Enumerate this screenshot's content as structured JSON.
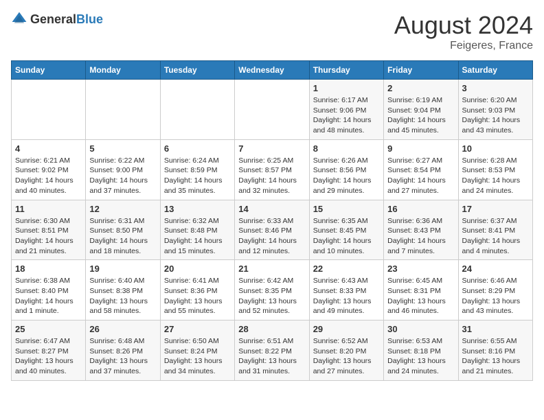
{
  "header": {
    "logo_general": "General",
    "logo_blue": "Blue",
    "month_year": "August 2024",
    "location": "Feigeres, France"
  },
  "calendar": {
    "days_of_week": [
      "Sunday",
      "Monday",
      "Tuesday",
      "Wednesday",
      "Thursday",
      "Friday",
      "Saturday"
    ],
    "weeks": [
      [
        {
          "day": "",
          "info": ""
        },
        {
          "day": "",
          "info": ""
        },
        {
          "day": "",
          "info": ""
        },
        {
          "day": "",
          "info": ""
        },
        {
          "day": "1",
          "info": "Sunrise: 6:17 AM\nSunset: 9:06 PM\nDaylight: 14 hours\nand 48 minutes."
        },
        {
          "day": "2",
          "info": "Sunrise: 6:19 AM\nSunset: 9:04 PM\nDaylight: 14 hours\nand 45 minutes."
        },
        {
          "day": "3",
          "info": "Sunrise: 6:20 AM\nSunset: 9:03 PM\nDaylight: 14 hours\nand 43 minutes."
        }
      ],
      [
        {
          "day": "4",
          "info": "Sunrise: 6:21 AM\nSunset: 9:02 PM\nDaylight: 14 hours\nand 40 minutes."
        },
        {
          "day": "5",
          "info": "Sunrise: 6:22 AM\nSunset: 9:00 PM\nDaylight: 14 hours\nand 37 minutes."
        },
        {
          "day": "6",
          "info": "Sunrise: 6:24 AM\nSunset: 8:59 PM\nDaylight: 14 hours\nand 35 minutes."
        },
        {
          "day": "7",
          "info": "Sunrise: 6:25 AM\nSunset: 8:57 PM\nDaylight: 14 hours\nand 32 minutes."
        },
        {
          "day": "8",
          "info": "Sunrise: 6:26 AM\nSunset: 8:56 PM\nDaylight: 14 hours\nand 29 minutes."
        },
        {
          "day": "9",
          "info": "Sunrise: 6:27 AM\nSunset: 8:54 PM\nDaylight: 14 hours\nand 27 minutes."
        },
        {
          "day": "10",
          "info": "Sunrise: 6:28 AM\nSunset: 8:53 PM\nDaylight: 14 hours\nand 24 minutes."
        }
      ],
      [
        {
          "day": "11",
          "info": "Sunrise: 6:30 AM\nSunset: 8:51 PM\nDaylight: 14 hours\nand 21 minutes."
        },
        {
          "day": "12",
          "info": "Sunrise: 6:31 AM\nSunset: 8:50 PM\nDaylight: 14 hours\nand 18 minutes."
        },
        {
          "day": "13",
          "info": "Sunrise: 6:32 AM\nSunset: 8:48 PM\nDaylight: 14 hours\nand 15 minutes."
        },
        {
          "day": "14",
          "info": "Sunrise: 6:33 AM\nSunset: 8:46 PM\nDaylight: 14 hours\nand 12 minutes."
        },
        {
          "day": "15",
          "info": "Sunrise: 6:35 AM\nSunset: 8:45 PM\nDaylight: 14 hours\nand 10 minutes."
        },
        {
          "day": "16",
          "info": "Sunrise: 6:36 AM\nSunset: 8:43 PM\nDaylight: 14 hours\nand 7 minutes."
        },
        {
          "day": "17",
          "info": "Sunrise: 6:37 AM\nSunset: 8:41 PM\nDaylight: 14 hours\nand 4 minutes."
        }
      ],
      [
        {
          "day": "18",
          "info": "Sunrise: 6:38 AM\nSunset: 8:40 PM\nDaylight: 14 hours\nand 1 minute."
        },
        {
          "day": "19",
          "info": "Sunrise: 6:40 AM\nSunset: 8:38 PM\nDaylight: 13 hours\nand 58 minutes."
        },
        {
          "day": "20",
          "info": "Sunrise: 6:41 AM\nSunset: 8:36 PM\nDaylight: 13 hours\nand 55 minutes."
        },
        {
          "day": "21",
          "info": "Sunrise: 6:42 AM\nSunset: 8:35 PM\nDaylight: 13 hours\nand 52 minutes."
        },
        {
          "day": "22",
          "info": "Sunrise: 6:43 AM\nSunset: 8:33 PM\nDaylight: 13 hours\nand 49 minutes."
        },
        {
          "day": "23",
          "info": "Sunrise: 6:45 AM\nSunset: 8:31 PM\nDaylight: 13 hours\nand 46 minutes."
        },
        {
          "day": "24",
          "info": "Sunrise: 6:46 AM\nSunset: 8:29 PM\nDaylight: 13 hours\nand 43 minutes."
        }
      ],
      [
        {
          "day": "25",
          "info": "Sunrise: 6:47 AM\nSunset: 8:27 PM\nDaylight: 13 hours\nand 40 minutes."
        },
        {
          "day": "26",
          "info": "Sunrise: 6:48 AM\nSunset: 8:26 PM\nDaylight: 13 hours\nand 37 minutes."
        },
        {
          "day": "27",
          "info": "Sunrise: 6:50 AM\nSunset: 8:24 PM\nDaylight: 13 hours\nand 34 minutes."
        },
        {
          "day": "28",
          "info": "Sunrise: 6:51 AM\nSunset: 8:22 PM\nDaylight: 13 hours\nand 31 minutes."
        },
        {
          "day": "29",
          "info": "Sunrise: 6:52 AM\nSunset: 8:20 PM\nDaylight: 13 hours\nand 27 minutes."
        },
        {
          "day": "30",
          "info": "Sunrise: 6:53 AM\nSunset: 8:18 PM\nDaylight: 13 hours\nand 24 minutes."
        },
        {
          "day": "31",
          "info": "Sunrise: 6:55 AM\nSunset: 8:16 PM\nDaylight: 13 hours\nand 21 minutes."
        }
      ]
    ]
  }
}
